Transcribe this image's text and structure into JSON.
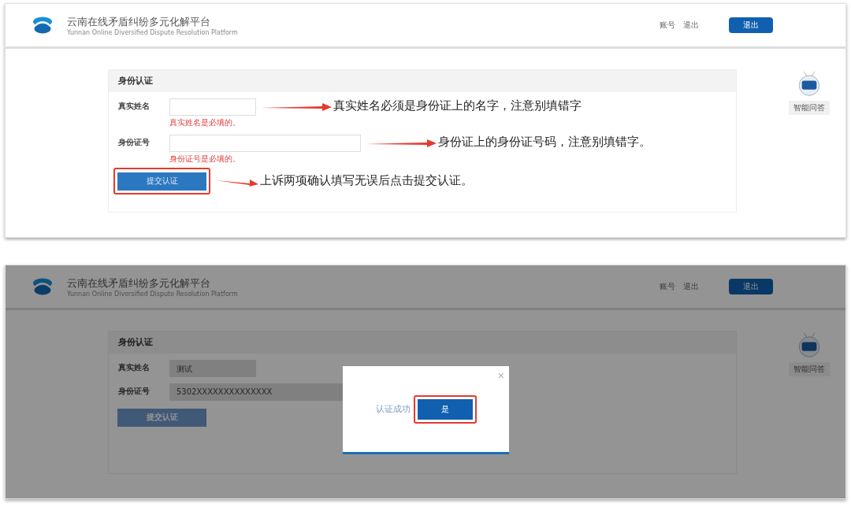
{
  "screens": [
    {
      "kind": "form",
      "header": {
        "title": "云南在线矛盾纠纷多元化解平台",
        "subtitle": "Yunnan Online Diversified Dispute Resolution Platform",
        "links": [
          "账号",
          "退出"
        ],
        "button": "退出"
      },
      "card": {
        "title": "身份认证",
        "fields": [
          {
            "label": "真实姓名",
            "disabled": false,
            "error": "真实姓名是必填的。",
            "note": "真实姓名必须是身份证上的名字，注意别填错字"
          },
          {
            "label": "身份证号",
            "disabled": false,
            "wide": true,
            "error": "身份证号是必填的。",
            "note": "身份证上的身份证号码，注意别填错字。"
          }
        ],
        "submit": {
          "label": "提交认证",
          "highlighted": true,
          "disabled": false,
          "note": "上诉两项确认填写无误后点击提交认证。"
        }
      },
      "widget": "智能问答"
    },
    {
      "kind": "dialog",
      "header": {
        "title": "云南在线矛盾纠纷多元化解平台",
        "subtitle": "Yunnan Online Diversified Dispute Resolution Platform",
        "links": [
          "账号",
          "退出"
        ],
        "button": "退出"
      },
      "card": {
        "title": "身份认证",
        "fields": [
          {
            "label": "真实姓名",
            "disabled": true,
            "value": "测试"
          },
          {
            "label": "身份证号",
            "disabled": true,
            "wide": true,
            "value": "5302XXXXXXXXXXXXXX"
          }
        ],
        "submit": {
          "label": "提交认证",
          "highlighted": false,
          "disabled": true
        }
      },
      "widget": "智能问答",
      "dialog": {
        "message": "认证成功",
        "button": "是",
        "close": "×",
        "highlighted": true
      }
    }
  ]
}
